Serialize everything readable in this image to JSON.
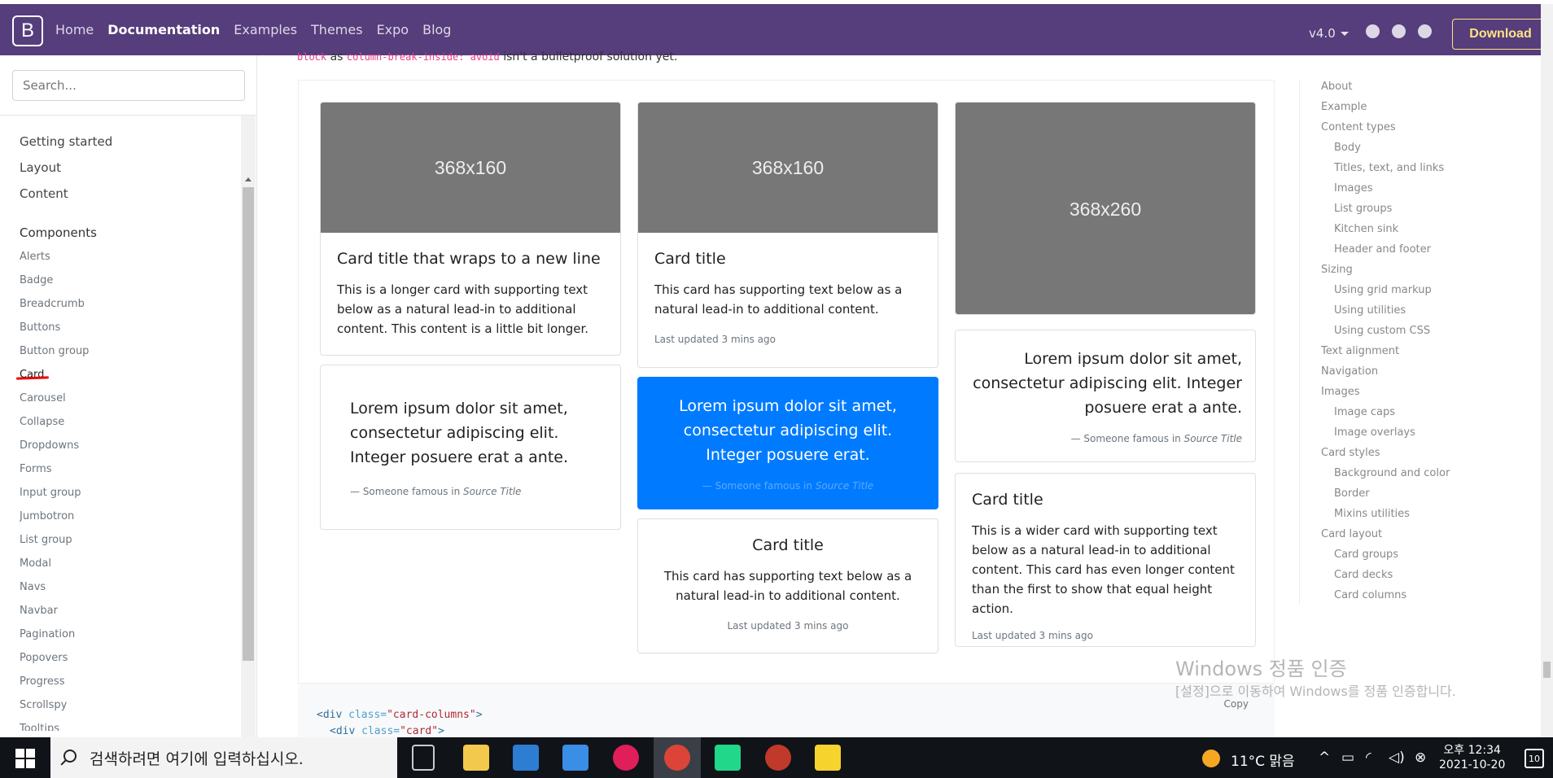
{
  "navbar": {
    "brand": "B",
    "links": [
      "Home",
      "Documentation",
      "Examples",
      "Themes",
      "Expo",
      "Blog"
    ],
    "active_link": "Documentation",
    "version": "v4.0",
    "download_label": "Download"
  },
  "sidebar": {
    "search_placeholder": "Search...",
    "groups": [
      "Getting started",
      "Layout",
      "Content"
    ],
    "components_heading": "Components",
    "components": [
      "Alerts",
      "Badge",
      "Breadcrumb",
      "Buttons",
      "Button group",
      "Card",
      "Carousel",
      "Collapse",
      "Dropdowns",
      "Forms",
      "Input group",
      "Jumbotron",
      "List group",
      "Modal",
      "Navs",
      "Navbar",
      "Pagination",
      "Popovers",
      "Progress",
      "Scrollspy",
      "Tooltips"
    ],
    "current": "Card"
  },
  "main": {
    "cutoff_code1": "block",
    "cutoff_text1": " as ",
    "cutoff_code2": "column-break-inside: avoid",
    "cutoff_text2": " isn't a bulletproof solution yet.",
    "cards": {
      "c1_img": "368x160",
      "c1_title": "Card title that wraps to a new line",
      "c1_text": "This is a longer card with supporting text below as a natural lead-in to additional content. This content is a little bit longer.",
      "c2_quote": "Lorem ipsum dolor sit amet, consectetur adipiscing elit. Integer posuere erat a ante.",
      "c2_footer_pre": "— Someone famous in ",
      "c2_footer_src": "Source Title",
      "c3_img": "368x160",
      "c3_title": "Card title",
      "c3_text": "This card has supporting text below as a natural lead-in to additional content.",
      "c3_muted": "Last updated 3 mins ago",
      "c4_quote": "Lorem ipsum dolor sit amet, consectetur adipiscing elit. Integer posuere erat.",
      "c4_footer_pre": "— Someone famous in ",
      "c4_footer_src": "Source Title",
      "c5_title": "Card title",
      "c5_text": "This card has supporting text below as a natural lead-in to additional content.",
      "c5_muted": "Last updated 3 mins ago",
      "c6_img": "368x260",
      "c7_quote": "Lorem ipsum dolor sit amet, consectetur adipiscing elit. Integer posuere erat a ante.",
      "c7_footer_pre": "— Someone famous in ",
      "c7_footer_src": "Source Title",
      "c8_title": "Card title",
      "c8_text": "This is a wider card with supporting text below as a natural lead-in to additional content. This card has even longer content than the first to show that equal height action.",
      "c8_muted": "Last updated 3 mins ago"
    },
    "code": {
      "copy_label": "Copy",
      "line1_tag_open": "<div ",
      "line1_attr": "class=",
      "line1_val": "\"card-columns\"",
      "line1_tag_close": ">",
      "line2_tag_open": "<div ",
      "line2_attr": "class=",
      "line2_val": "\"card\"",
      "line2_tag_close": ">"
    }
  },
  "toc": [
    {
      "label": "About",
      "level": 1
    },
    {
      "label": "Example",
      "level": 1
    },
    {
      "label": "Content types",
      "level": 1
    },
    {
      "label": "Body",
      "level": 2
    },
    {
      "label": "Titles, text, and links",
      "level": 2
    },
    {
      "label": "Images",
      "level": 2
    },
    {
      "label": "List groups",
      "level": 2
    },
    {
      "label": "Kitchen sink",
      "level": 2
    },
    {
      "label": "Header and footer",
      "level": 2
    },
    {
      "label": "Sizing",
      "level": 1
    },
    {
      "label": "Using grid markup",
      "level": 2
    },
    {
      "label": "Using utilities",
      "level": 2
    },
    {
      "label": "Using custom CSS",
      "level": 2
    },
    {
      "label": "Text alignment",
      "level": 1
    },
    {
      "label": "Navigation",
      "level": 1
    },
    {
      "label": "Images",
      "level": 1
    },
    {
      "label": "Image caps",
      "level": 2
    },
    {
      "label": "Image overlays",
      "level": 2
    },
    {
      "label": "Card styles",
      "level": 1
    },
    {
      "label": "Background and color",
      "level": 2
    },
    {
      "label": "Border",
      "level": 2
    },
    {
      "label": "Mixins utilities",
      "level": 2
    },
    {
      "label": "Card layout",
      "level": 1
    },
    {
      "label": "Card groups",
      "level": 2
    },
    {
      "label": "Card decks",
      "level": 2
    },
    {
      "label": "Card columns",
      "level": 2
    }
  ],
  "watermark": {
    "line1": "Windows 정품 인증",
    "line2": "[설정]으로 이동하여 Windows를 정품 인증합니다."
  },
  "taskbar": {
    "search_placeholder": "검색하려면 여기에 입력하십시오.",
    "weather": "11°C 맑음",
    "time": "오후 12:34",
    "date": "2021-10-20",
    "notification_count": "10"
  },
  "colors": {
    "navbar": "#563d7c",
    "download": "#ffe484",
    "primary_card": "#007bff",
    "placeholder_img": "#777777"
  }
}
